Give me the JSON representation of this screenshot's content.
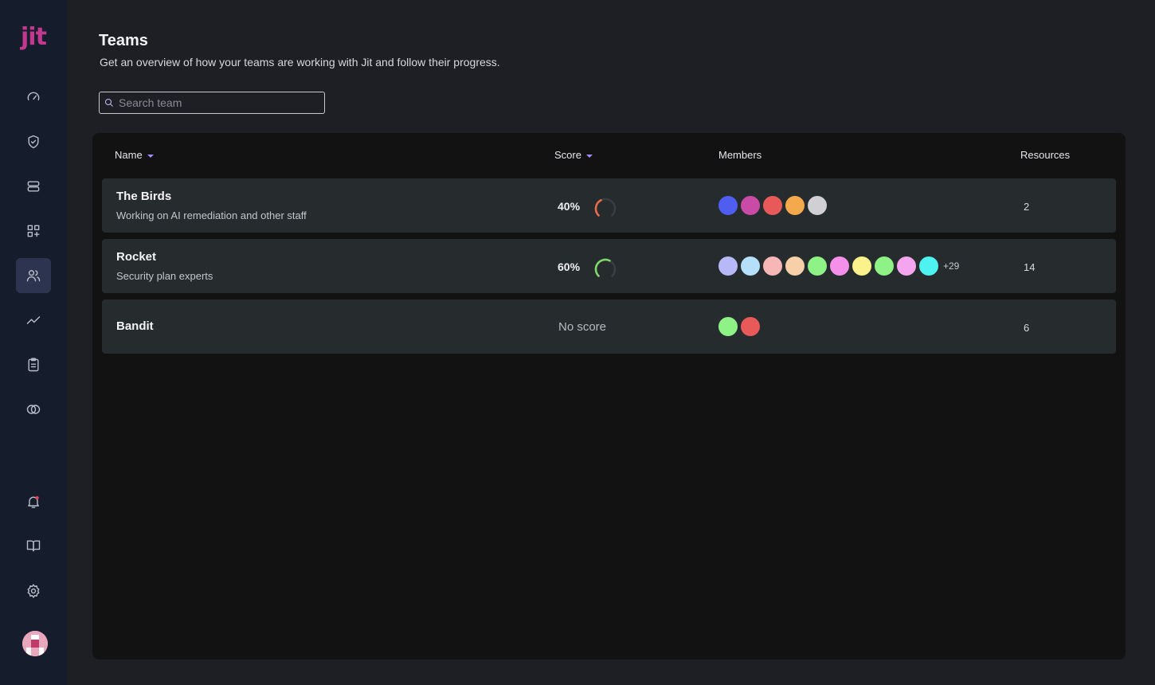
{
  "logo": "jit",
  "page": {
    "title": "Teams",
    "subtitle": "Get an overview of how your teams are working with Jit and follow their progress."
  },
  "search": {
    "placeholder": "Search team",
    "value": ""
  },
  "sidebar": {
    "items": [
      {
        "icon": "speedometer-icon",
        "active": false
      },
      {
        "icon": "shield-check-icon",
        "active": false
      },
      {
        "icon": "stack-icon",
        "active": false
      },
      {
        "icon": "apps-add-icon",
        "active": false
      },
      {
        "icon": "users-icon",
        "active": true
      },
      {
        "icon": "trend-icon",
        "active": false
      },
      {
        "icon": "clipboard-icon",
        "active": false
      },
      {
        "icon": "rings-icon",
        "active": false
      }
    ],
    "bottom": [
      {
        "icon": "bell-icon",
        "badge_color": "#e8435a"
      },
      {
        "icon": "book-icon"
      },
      {
        "icon": "gear-icon"
      }
    ]
  },
  "table": {
    "columns": {
      "name": "Name",
      "score": "Score",
      "members": "Members",
      "resources": "Resources"
    },
    "rows": [
      {
        "name": "The Birds",
        "description": "Working on AI remediation and other staff",
        "score": "40%",
        "score_fraction": 0.4,
        "members": [
          "#4f5df0",
          "#c84ca6",
          "#e85a5a",
          "#f5a94d",
          "#cfcfd4"
        ],
        "more_members": "",
        "resources": "2"
      },
      {
        "name": "Rocket",
        "description": "Security plan experts",
        "score": "60%",
        "score_fraction": 0.6,
        "members": [
          "#b7b8f7",
          "#b6dffa",
          "#f7b7b7",
          "#f7cfa8",
          "#8ef286",
          "#f590ea",
          "#fbf28c",
          "#8ef286",
          "#f5a4ee",
          "#4ef2f0"
        ],
        "more_members": "+29",
        "resources": "14"
      },
      {
        "name": "Bandit",
        "description": "",
        "score": "No score",
        "score_fraction": null,
        "members": [
          "#8ef286",
          "#e85a5a"
        ],
        "more_members": "",
        "resources": "6"
      }
    ]
  },
  "colors": {
    "accent": "#a48cff",
    "brand": "#c2388f",
    "gauge_low": "#e86a4a",
    "gauge_high": "#7fd86a"
  }
}
